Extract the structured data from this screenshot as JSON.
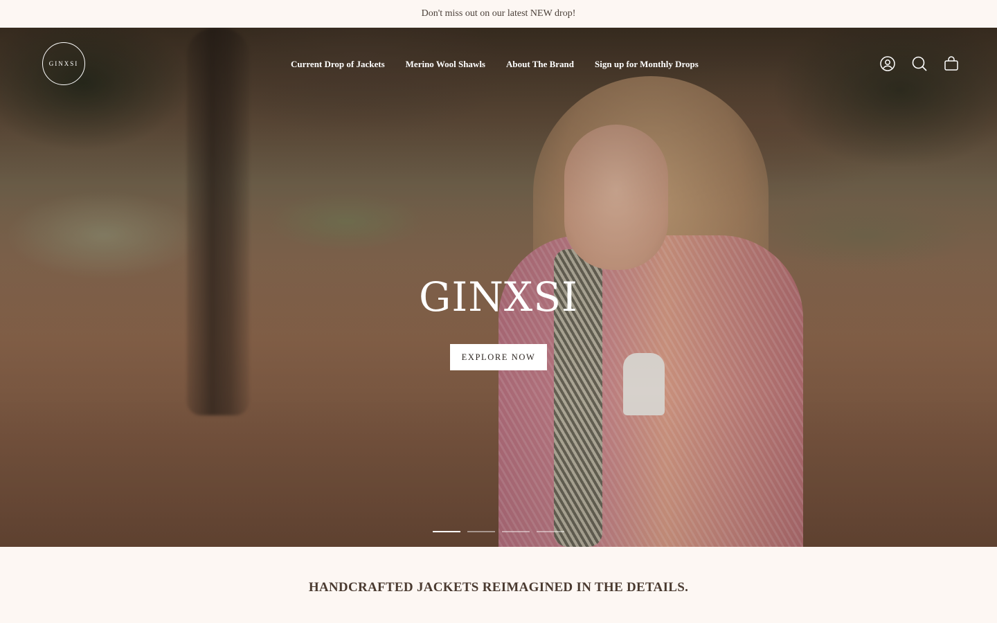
{
  "announcement": {
    "text": "Don't miss out on our latest NEW drop!"
  },
  "header": {
    "logo_text": "GINXSI",
    "nav": [
      {
        "label": "Current Drop of Jackets"
      },
      {
        "label": "Merino Wool Shawls"
      },
      {
        "label": "About The Brand"
      },
      {
        "label": "Sign up for Monthly Drops"
      }
    ],
    "icons": [
      "account-icon",
      "search-icon",
      "cart-icon"
    ]
  },
  "hero": {
    "title": "GINXSI",
    "cta_label": "EXPLORE NOW",
    "slides_total": 4,
    "active_slide": 1
  },
  "intro": {
    "tagline": "HANDCRAFTED JACKETS REIMAGINED IN THE DETAILS."
  },
  "colors": {
    "background": "#fdf7f3",
    "text": "#3b2f28",
    "nav_text": "#ffffff",
    "cta_bg": "#ffffff"
  }
}
